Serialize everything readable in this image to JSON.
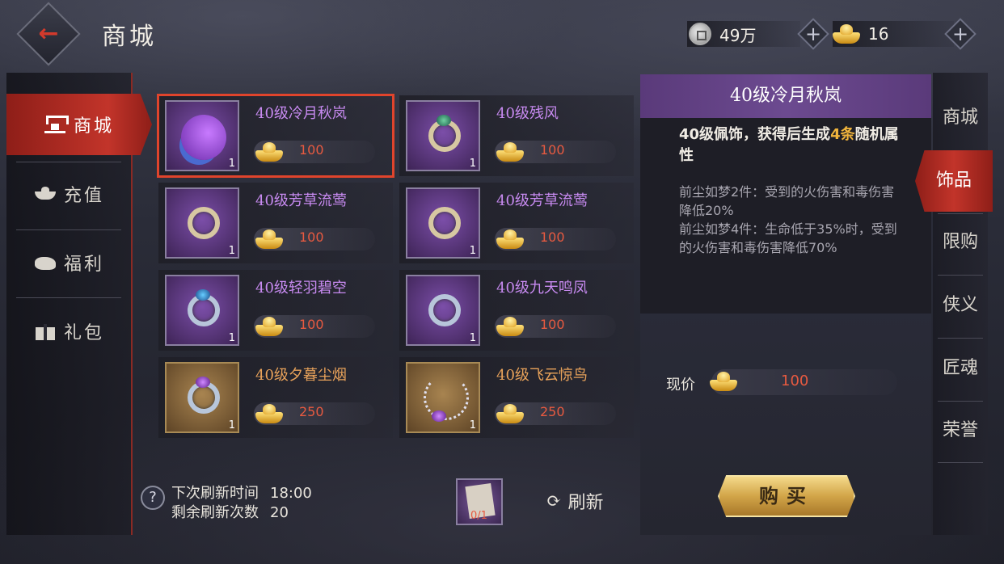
{
  "header": {
    "back_icon": "back-arrow-icon",
    "title": "商城",
    "silver": {
      "icon": "silver-coin-icon",
      "value": "49万"
    },
    "gold": {
      "icon": "gold-ingot-icon",
      "value": "16"
    }
  },
  "left_nav": {
    "items": [
      {
        "label": "商城",
        "icon": "shop-icon",
        "active": true
      },
      {
        "label": "充值",
        "icon": "recharge-icon",
        "active": false
      },
      {
        "label": "福利",
        "icon": "welfare-icon",
        "active": false
      },
      {
        "label": "礼包",
        "icon": "gift-icon",
        "active": false
      }
    ]
  },
  "items": [
    {
      "name": "40级冷月秋岚",
      "price": "100",
      "count": "1",
      "rarity": "purple",
      "selected": true
    },
    {
      "name": "40级残风",
      "price": "100",
      "count": "1",
      "rarity": "purple",
      "selected": false
    },
    {
      "name": "40级芳草流莺",
      "price": "100",
      "count": "1",
      "rarity": "purple",
      "selected": false
    },
    {
      "name": "40级芳草流莺",
      "price": "100",
      "count": "1",
      "rarity": "purple",
      "selected": false
    },
    {
      "name": "40级轻羽碧空",
      "price": "100",
      "count": "1",
      "rarity": "purple",
      "selected": false
    },
    {
      "name": "40级九天鸣凤",
      "price": "100",
      "count": "1",
      "rarity": "purple",
      "selected": false
    },
    {
      "name": "40级夕暮尘烟",
      "price": "250",
      "count": "1",
      "rarity": "orange",
      "selected": false
    },
    {
      "name": "40级飞云惊鸟",
      "price": "250",
      "count": "1",
      "rarity": "orange",
      "selected": false
    }
  ],
  "refresh": {
    "help": "?",
    "next_label": "下次刷新时间",
    "next_value": "18:00",
    "remain_label": "剩余刷新次数",
    "remain_value": "20",
    "scroll_count": "0/1",
    "button_label": "刷新"
  },
  "detail": {
    "title": "40级冷月秋岚",
    "desc_prefix": "40级佩饰，获得后生成",
    "desc_highlight": "4条",
    "desc_suffix": "随机属性",
    "set_bonus_1": "前尘如梦2件：受到的火伤害和毒伤害降低20%",
    "set_bonus_2": "前尘如梦4件：生命低于35%时，受到的火伤害和毒伤害降低70%",
    "price_label": "现价",
    "price": "100",
    "buy_label": "购买"
  },
  "right_tabs": [
    {
      "label": "商城",
      "active": false
    },
    {
      "label": "饰品",
      "active": true
    },
    {
      "label": "限购",
      "active": false
    },
    {
      "label": "侠义",
      "active": false
    },
    {
      "label": "匠魂",
      "active": false
    },
    {
      "label": "荣誉",
      "active": false
    }
  ],
  "colors": {
    "accent_red": "#c2342a",
    "purple_name": "#c78af0",
    "orange_name": "#e8a25a",
    "price_red": "#e85a40",
    "highlight_gold": "#f0b43c"
  }
}
